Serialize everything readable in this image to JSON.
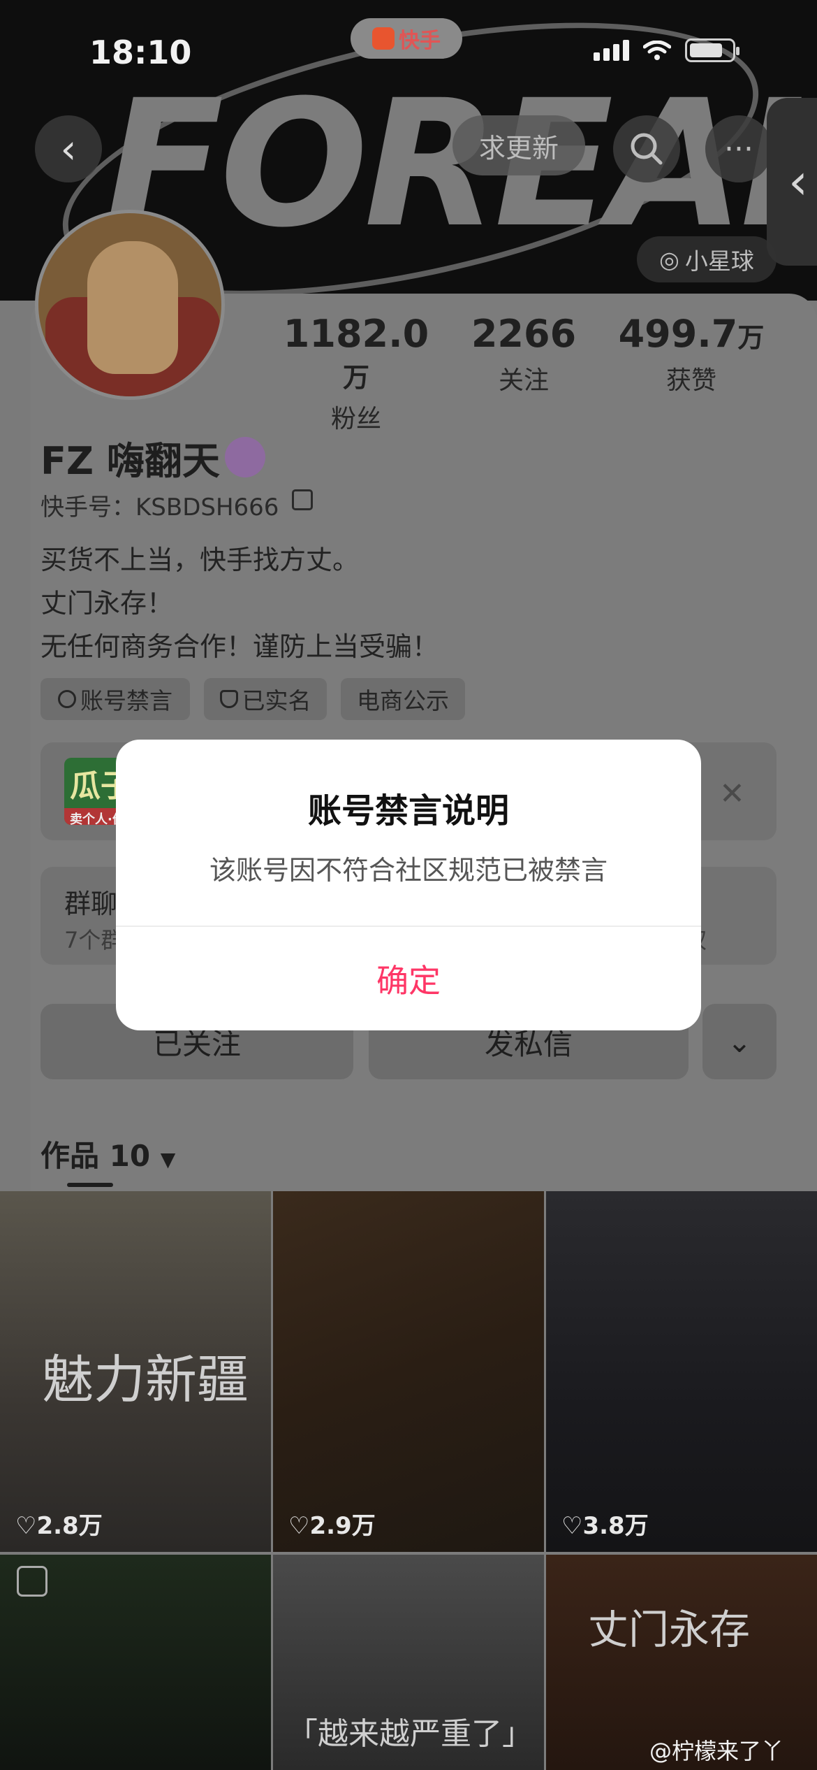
{
  "status_bar": {
    "time": "18:10",
    "app_name": "快手"
  },
  "header": {
    "banner_word": "FOREAL",
    "back_icon": "chevron-left-icon",
    "update_button": "求更新",
    "search_icon": "search-icon",
    "more_icon": "more-dots-icon",
    "side_tab_icon": "chevron-left-icon",
    "planet_tag": "小星球"
  },
  "profile": {
    "stats": [
      {
        "value": "1182.0",
        "unit": "万",
        "label": "粉丝"
      },
      {
        "value": "2266",
        "unit": "",
        "label": "关注"
      },
      {
        "value": "499.7",
        "unit": "万",
        "label": "获赞"
      }
    ],
    "name": "FZ 嗨翻天",
    "kuaishou_id": "快手号：KSBDSH666",
    "bio": [
      "买货不上当，快手找方丈。",
      "丈门永存！",
      "无任何商务合作！谨防上当受骗！"
    ],
    "tags": [
      "账号禁言",
      "已实名",
      "电商公示"
    ]
  },
  "shop_card": {
    "logo_text": "瓜子",
    "logo_sub": "卖个人·价更"
  },
  "group_card": {
    "title": "群聊",
    "subtitle": "7个群",
    "right": "权"
  },
  "actions": {
    "follow": "已关注",
    "message": "发私信"
  },
  "works": {
    "tab_label": "作品 10",
    "tiles": [
      {
        "likes": "2.8万",
        "caption": "魅力新疆"
      },
      {
        "likes": "2.9万",
        "caption": ""
      },
      {
        "likes": "3.8万",
        "caption": ""
      },
      {
        "likes": "",
        "caption": ""
      },
      {
        "likes": "",
        "caption": "「越来越严重了」"
      },
      {
        "likes": "",
        "caption": "丈门永存"
      }
    ]
  },
  "dialog": {
    "title": "账号禁言说明",
    "message": "该账号因不符合社区规范已被禁言",
    "confirm": "确定"
  },
  "watermark": "@柠檬来了丫",
  "colors": {
    "accent": "#fe3666",
    "dim": "#7c7c7c"
  }
}
